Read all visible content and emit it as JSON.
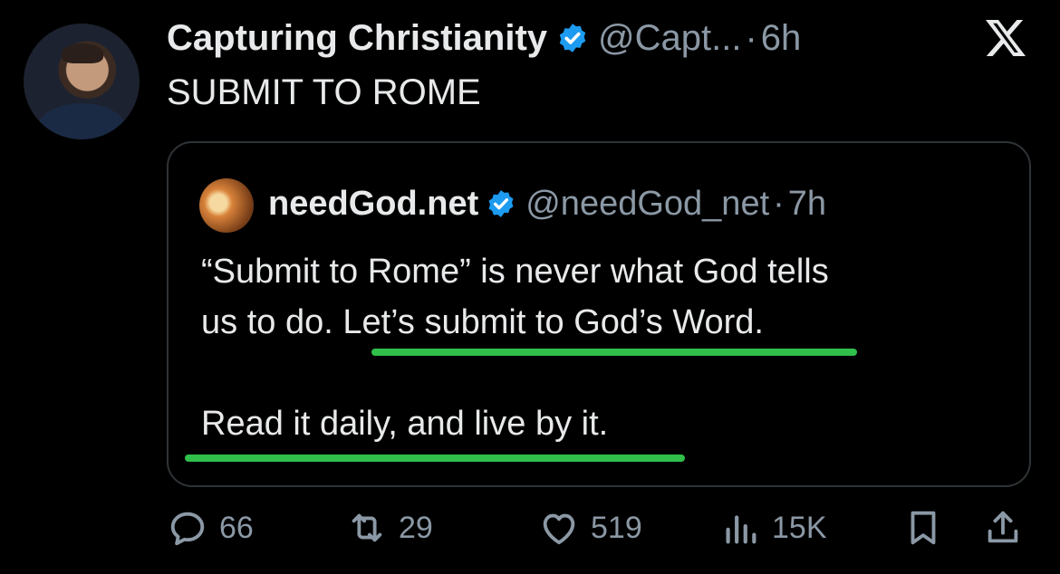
{
  "post": {
    "author_name": "Capturing Christianity",
    "author_handle": "@Capt...",
    "separator": "·",
    "time": "6h",
    "text": "SUBMIT TO ROME"
  },
  "quote": {
    "author_name": "needGod.net",
    "author_handle": "@needGod_net",
    "separator": "·",
    "time": "7h",
    "line1": "“Submit to Rome” is never what God tells",
    "line2": "us to do. Let’s submit to God’s Word.",
    "line3": "",
    "line4": "Read it daily, and live by it."
  },
  "actions": {
    "replies": "66",
    "reposts": "29",
    "likes": "519",
    "views": "15K"
  },
  "colors": {
    "verified": "#1d9bf0",
    "underline": "#2fbf4a",
    "muted": "#8b98a5",
    "card_border": "#2f3336"
  },
  "icons": [
    "verified-badge-icon",
    "x-logo-icon",
    "reply-icon",
    "repost-icon",
    "like-icon",
    "views-icon",
    "bookmark-icon",
    "share-icon"
  ]
}
